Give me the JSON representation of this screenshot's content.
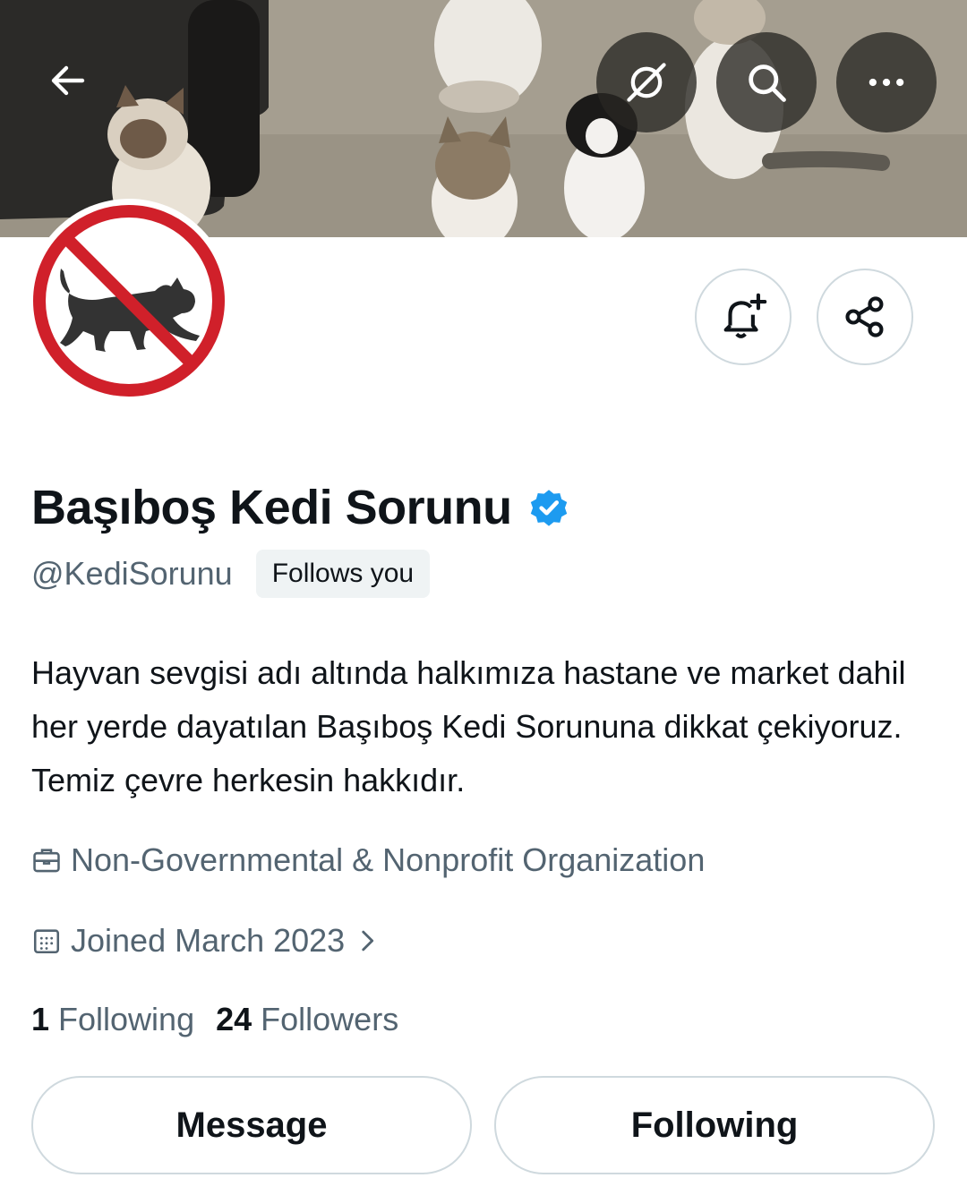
{
  "banner": {
    "back_icon": "arrow-left-icon",
    "grok_icon": "grok-icon",
    "search_icon": "search-icon",
    "more_icon": "more-dots-icon"
  },
  "profile": {
    "display_name": "Başıboş Kedi Sorunu",
    "verified": true,
    "handle": "@KediSorunu",
    "follows_you": "Follows you",
    "bio": "Hayvan sevgisi adı altında halkımıza hastane ve market dahil her yerde dayatılan Başıboş Kedi Sorununa dikkat çekiyoruz. Temiz çevre herkesin hakkıdır.",
    "category": "Non-Governmental & Nonprofit Organization",
    "joined": "Joined March 2023",
    "following_count": "1",
    "following_label": "Following",
    "followers_count": "24",
    "followers_label": "Followers"
  },
  "actions": {
    "notify_icon": "bell-plus-icon",
    "share_icon": "share-icon",
    "message_label": "Message",
    "following_label": "Following"
  },
  "colors": {
    "accent": "#1d9bf0",
    "no_sign_red": "#d0202a",
    "secondary_text": "#536471"
  }
}
